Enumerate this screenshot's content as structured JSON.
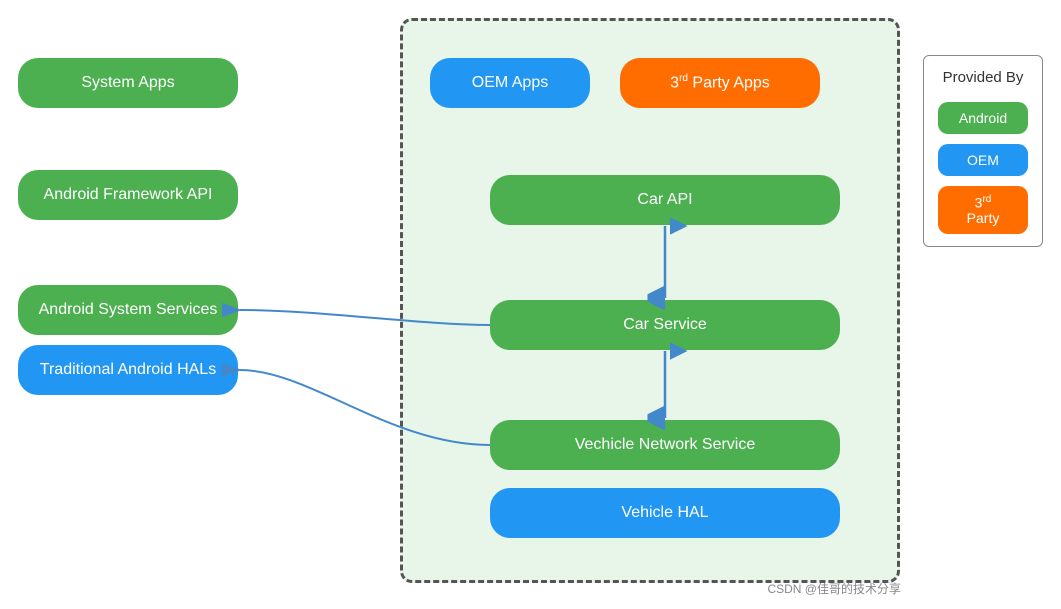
{
  "left_boxes": {
    "system_apps": "System Apps",
    "android_framework": "Android Framework API",
    "android_system_services": "Android System Services",
    "traditional_hal": "Traditional Android HALs"
  },
  "inner_boxes": {
    "oem_apps": "OEM Apps",
    "third_party_apps_prefix": "3",
    "third_party_apps_suffix": " Party Apps",
    "car_api": "Car API",
    "car_service": "Car Service",
    "vehicle_network": "Vechicle Network Service",
    "vehicle_hal": "Vehicle HAL"
  },
  "legend": {
    "title": "Provided By",
    "android": "Android",
    "oem": "OEM",
    "third_party_prefix": "3",
    "third_party_suffix": "Party"
  },
  "watermark": "CSDN @佳哥的技术分享"
}
